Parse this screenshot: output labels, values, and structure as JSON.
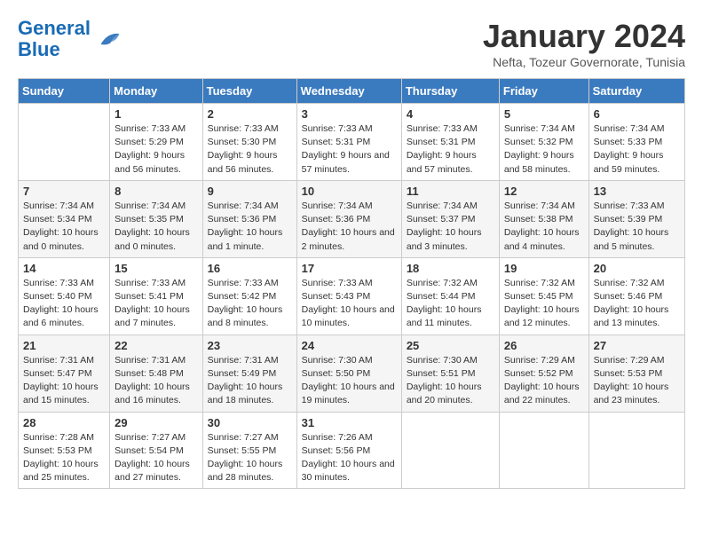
{
  "header": {
    "logo_line1": "General",
    "logo_line2": "Blue",
    "month_title": "January 2024",
    "subtitle": "Nefta, Tozeur Governorate, Tunisia"
  },
  "weekdays": [
    "Sunday",
    "Monday",
    "Tuesday",
    "Wednesday",
    "Thursday",
    "Friday",
    "Saturday"
  ],
  "weeks": [
    [
      {
        "day": "",
        "sunrise": "",
        "sunset": "",
        "daylight": ""
      },
      {
        "day": "1",
        "sunrise": "Sunrise: 7:33 AM",
        "sunset": "Sunset: 5:29 PM",
        "daylight": "Daylight: 9 hours and 56 minutes."
      },
      {
        "day": "2",
        "sunrise": "Sunrise: 7:33 AM",
        "sunset": "Sunset: 5:30 PM",
        "daylight": "Daylight: 9 hours and 56 minutes."
      },
      {
        "day": "3",
        "sunrise": "Sunrise: 7:33 AM",
        "sunset": "Sunset: 5:31 PM",
        "daylight": "Daylight: 9 hours and 57 minutes."
      },
      {
        "day": "4",
        "sunrise": "Sunrise: 7:33 AM",
        "sunset": "Sunset: 5:31 PM",
        "daylight": "Daylight: 9 hours and 57 minutes."
      },
      {
        "day": "5",
        "sunrise": "Sunrise: 7:34 AM",
        "sunset": "Sunset: 5:32 PM",
        "daylight": "Daylight: 9 hours and 58 minutes."
      },
      {
        "day": "6",
        "sunrise": "Sunrise: 7:34 AM",
        "sunset": "Sunset: 5:33 PM",
        "daylight": "Daylight: 9 hours and 59 minutes."
      }
    ],
    [
      {
        "day": "7",
        "sunrise": "Sunrise: 7:34 AM",
        "sunset": "Sunset: 5:34 PM",
        "daylight": "Daylight: 10 hours and 0 minutes."
      },
      {
        "day": "8",
        "sunrise": "Sunrise: 7:34 AM",
        "sunset": "Sunset: 5:35 PM",
        "daylight": "Daylight: 10 hours and 0 minutes."
      },
      {
        "day": "9",
        "sunrise": "Sunrise: 7:34 AM",
        "sunset": "Sunset: 5:36 PM",
        "daylight": "Daylight: 10 hours and 1 minute."
      },
      {
        "day": "10",
        "sunrise": "Sunrise: 7:34 AM",
        "sunset": "Sunset: 5:36 PM",
        "daylight": "Daylight: 10 hours and 2 minutes."
      },
      {
        "day": "11",
        "sunrise": "Sunrise: 7:34 AM",
        "sunset": "Sunset: 5:37 PM",
        "daylight": "Daylight: 10 hours and 3 minutes."
      },
      {
        "day": "12",
        "sunrise": "Sunrise: 7:34 AM",
        "sunset": "Sunset: 5:38 PM",
        "daylight": "Daylight: 10 hours and 4 minutes."
      },
      {
        "day": "13",
        "sunrise": "Sunrise: 7:33 AM",
        "sunset": "Sunset: 5:39 PM",
        "daylight": "Daylight: 10 hours and 5 minutes."
      }
    ],
    [
      {
        "day": "14",
        "sunrise": "Sunrise: 7:33 AM",
        "sunset": "Sunset: 5:40 PM",
        "daylight": "Daylight: 10 hours and 6 minutes."
      },
      {
        "day": "15",
        "sunrise": "Sunrise: 7:33 AM",
        "sunset": "Sunset: 5:41 PM",
        "daylight": "Daylight: 10 hours and 7 minutes."
      },
      {
        "day": "16",
        "sunrise": "Sunrise: 7:33 AM",
        "sunset": "Sunset: 5:42 PM",
        "daylight": "Daylight: 10 hours and 8 minutes."
      },
      {
        "day": "17",
        "sunrise": "Sunrise: 7:33 AM",
        "sunset": "Sunset: 5:43 PM",
        "daylight": "Daylight: 10 hours and 10 minutes."
      },
      {
        "day": "18",
        "sunrise": "Sunrise: 7:32 AM",
        "sunset": "Sunset: 5:44 PM",
        "daylight": "Daylight: 10 hours and 11 minutes."
      },
      {
        "day": "19",
        "sunrise": "Sunrise: 7:32 AM",
        "sunset": "Sunset: 5:45 PM",
        "daylight": "Daylight: 10 hours and 12 minutes."
      },
      {
        "day": "20",
        "sunrise": "Sunrise: 7:32 AM",
        "sunset": "Sunset: 5:46 PM",
        "daylight": "Daylight: 10 hours and 13 minutes."
      }
    ],
    [
      {
        "day": "21",
        "sunrise": "Sunrise: 7:31 AM",
        "sunset": "Sunset: 5:47 PM",
        "daylight": "Daylight: 10 hours and 15 minutes."
      },
      {
        "day": "22",
        "sunrise": "Sunrise: 7:31 AM",
        "sunset": "Sunset: 5:48 PM",
        "daylight": "Daylight: 10 hours and 16 minutes."
      },
      {
        "day": "23",
        "sunrise": "Sunrise: 7:31 AM",
        "sunset": "Sunset: 5:49 PM",
        "daylight": "Daylight: 10 hours and 18 minutes."
      },
      {
        "day": "24",
        "sunrise": "Sunrise: 7:30 AM",
        "sunset": "Sunset: 5:50 PM",
        "daylight": "Daylight: 10 hours and 19 minutes."
      },
      {
        "day": "25",
        "sunrise": "Sunrise: 7:30 AM",
        "sunset": "Sunset: 5:51 PM",
        "daylight": "Daylight: 10 hours and 20 minutes."
      },
      {
        "day": "26",
        "sunrise": "Sunrise: 7:29 AM",
        "sunset": "Sunset: 5:52 PM",
        "daylight": "Daylight: 10 hours and 22 minutes."
      },
      {
        "day": "27",
        "sunrise": "Sunrise: 7:29 AM",
        "sunset": "Sunset: 5:53 PM",
        "daylight": "Daylight: 10 hours and 23 minutes."
      }
    ],
    [
      {
        "day": "28",
        "sunrise": "Sunrise: 7:28 AM",
        "sunset": "Sunset: 5:53 PM",
        "daylight": "Daylight: 10 hours and 25 minutes."
      },
      {
        "day": "29",
        "sunrise": "Sunrise: 7:27 AM",
        "sunset": "Sunset: 5:54 PM",
        "daylight": "Daylight: 10 hours and 27 minutes."
      },
      {
        "day": "30",
        "sunrise": "Sunrise: 7:27 AM",
        "sunset": "Sunset: 5:55 PM",
        "daylight": "Daylight: 10 hours and 28 minutes."
      },
      {
        "day": "31",
        "sunrise": "Sunrise: 7:26 AM",
        "sunset": "Sunset: 5:56 PM",
        "daylight": "Daylight: 10 hours and 30 minutes."
      },
      {
        "day": "",
        "sunrise": "",
        "sunset": "",
        "daylight": ""
      },
      {
        "day": "",
        "sunrise": "",
        "sunset": "",
        "daylight": ""
      },
      {
        "day": "",
        "sunrise": "",
        "sunset": "",
        "daylight": ""
      }
    ]
  ]
}
